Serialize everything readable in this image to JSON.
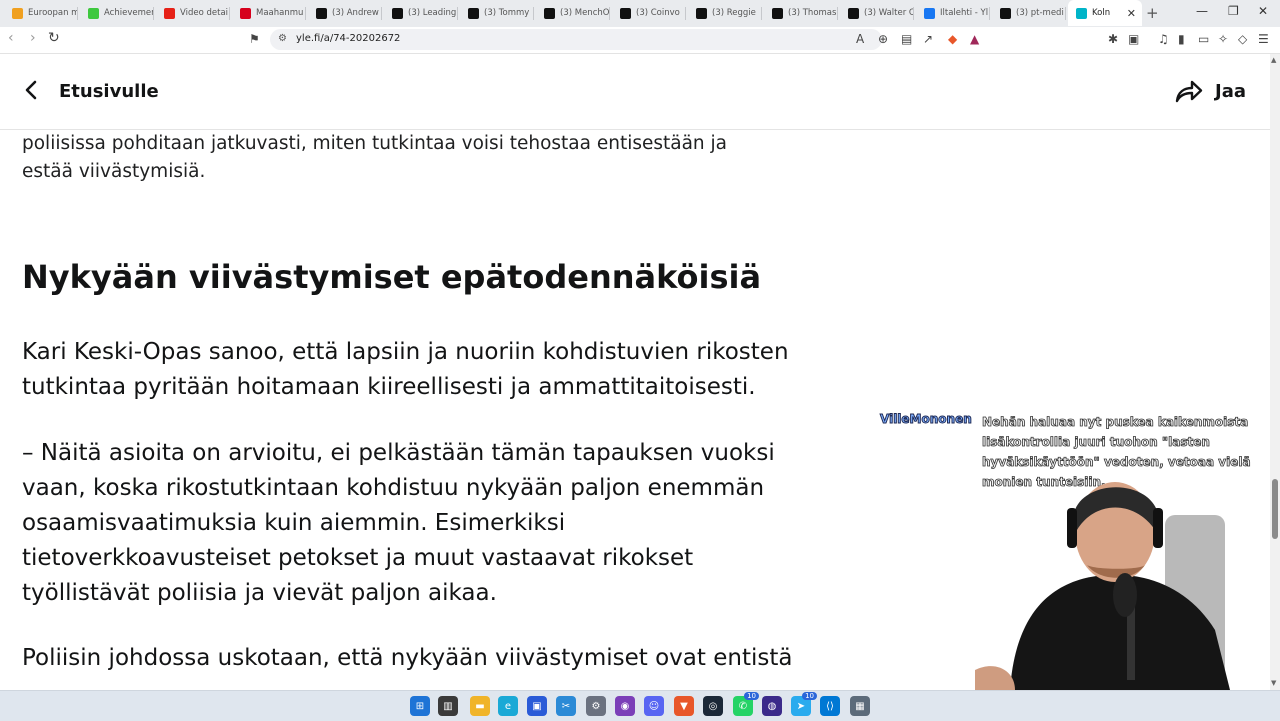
{
  "browser": {
    "tabs": [
      {
        "title": "Euroopan m",
        "icon": "yle-icon",
        "color": "#f0a020"
      },
      {
        "title": "Achievemen",
        "icon": "kick-icon",
        "color": "#3ec83e"
      },
      {
        "title": "Video detai",
        "icon": "youtube-icon",
        "color": "#e62117"
      },
      {
        "title": "Maahanmu",
        "icon": "il-icon",
        "color": "#d6001c"
      },
      {
        "title": "(3) Andrew",
        "icon": "x-icon",
        "color": "#111111"
      },
      {
        "title": "(3) Leading",
        "icon": "x-icon",
        "color": "#111111"
      },
      {
        "title": "(3) Tommy",
        "icon": "x-icon",
        "color": "#111111"
      },
      {
        "title": "(3) MenchO",
        "icon": "x-icon",
        "color": "#111111"
      },
      {
        "title": "(3) Coinvo",
        "icon": "x-icon",
        "color": "#111111"
      },
      {
        "title": "(3) Reggie",
        "icon": "x-icon",
        "color": "#111111"
      },
      {
        "title": "(3) Thomas",
        "icon": "x-icon",
        "color": "#111111"
      },
      {
        "title": "(3) Walter C",
        "icon": "x-icon",
        "color": "#111111"
      },
      {
        "title": "Iltalehti - Yl",
        "icon": "facebook-icon",
        "color": "#1877f2"
      },
      {
        "title": "(3) pt-medi",
        "icon": "x-icon",
        "color": "#111111"
      },
      {
        "title": "Koln",
        "icon": "yle-icon",
        "color": "#00b4c8",
        "active": true
      }
    ],
    "url": "yle.fi/a/74-20202672"
  },
  "header": {
    "back_label": "Etusivulle",
    "share_label": "Jaa"
  },
  "article": {
    "intro": "poliisissa pohditaan jatkuvasti, miten tutkintaa voisi tehostaa entisestään ja estää viivästymisiä.",
    "heading": "Nykyään viivästymiset epätodennäköisiä",
    "para1": "Kari Keski-Opas sanoo, että lapsiin ja nuoriin kohdistuvien rikosten tutkintaa pyritään hoitamaan kiireellisesti ja ammattitaitoisesti.",
    "para2": "– Näitä asioita on arvioitu, ei pelkästään tämän tapauksen vuoksi vaan, koska rikostutkintaan kohdistuu nykyään paljon enemmän osaamisvaatimuksia kuin aiemmin. Esimerkiksi tietoverkkoavusteiset petokset ja muut vastaavat rikokset työllistävät poliisia ja vievät paljon aikaa.",
    "para3": "Poliisin johdossa uskotaan, että nykyään viivästymiset ovat entistä"
  },
  "chat_overlay": {
    "username": "VilleMononen",
    "message": "Nehän haluaa nyt puskea kaikenmoista lisäkontrollia juuri tuohon \"lasten hyväksikäyttöön\" vedoten, vetoaa vielä monien tunteisiin."
  },
  "taskbar": {
    "badges": {
      "whatsapp": "10",
      "telegram": "10"
    }
  }
}
